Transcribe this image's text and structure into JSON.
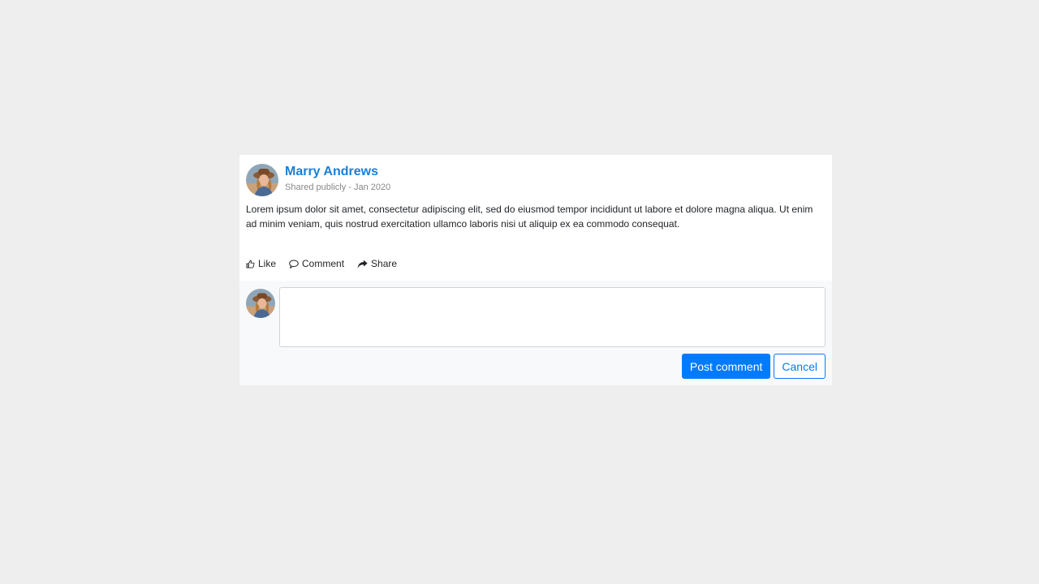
{
  "post": {
    "author_name": "Marry Andrews",
    "subtitle": "Shared publicly - Jan 2020",
    "body": "Lorem ipsum dolor sit amet, consectetur adipiscing elit, sed do eiusmod tempor incididunt ut labore et dolore magna aliqua. Ut enim ad minim veniam, quis nostrud exercitation ullamco laboris nisi ut aliquip ex ea commodo consequat."
  },
  "actions": {
    "like_label": "Like",
    "like_icon": "thumbs-up-icon",
    "comment_label": "Comment",
    "comment_icon": "speech-bubble-icon",
    "share_label": "Share",
    "share_icon": "share-arrow-icon"
  },
  "comment": {
    "value": "",
    "placeholder": "",
    "post_label": "Post comment",
    "cancel_label": "Cancel"
  },
  "colors": {
    "page_background": "#eeeeee",
    "author_name": "#1a7fd6",
    "primary": "#007bff",
    "comment_area_background": "#f8f9fa"
  }
}
